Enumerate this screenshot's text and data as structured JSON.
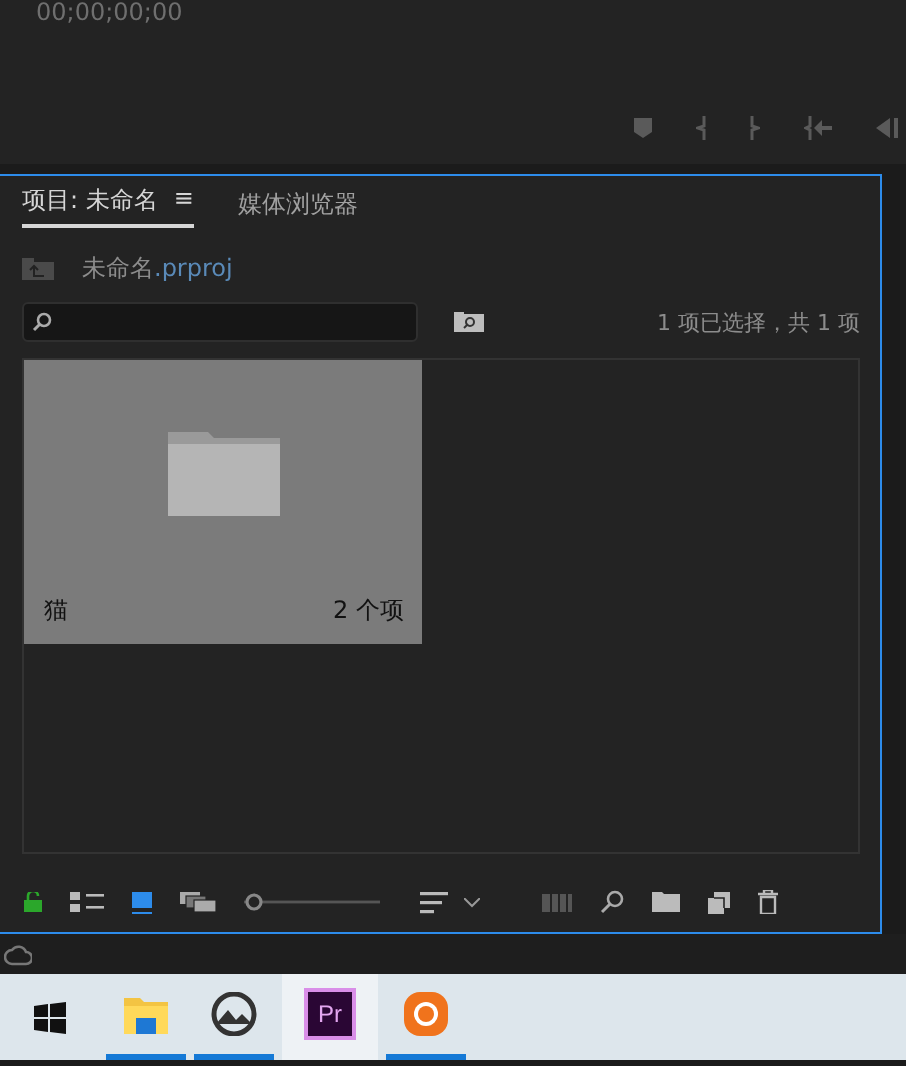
{
  "monitor": {
    "timecode": "00;00;00;00"
  },
  "panel": {
    "tabs": [
      {
        "label": "项目: 未命名",
        "selected": true,
        "menu": "≡"
      },
      {
        "label": "媒体浏览器",
        "selected": false
      }
    ],
    "project_file": {
      "name": "未命名",
      "extension": ".prproj"
    },
    "zoom_slider": {
      "level": 0
    },
    "selection_count": "1 项已选择，共 1 项",
    "items": [
      {
        "kind": "bin",
        "name": "猫",
        "count": "2 个项"
      }
    ]
  },
  "taskbar": {
    "apps": [
      {
        "kind": "explorer",
        "active": false,
        "running": true
      },
      {
        "kind": "photos",
        "active": false,
        "running": true
      },
      {
        "kind": "premiere",
        "label": "Pr",
        "active": true,
        "running": false
      },
      {
        "kind": "orange",
        "active": false,
        "running": true
      }
    ]
  }
}
